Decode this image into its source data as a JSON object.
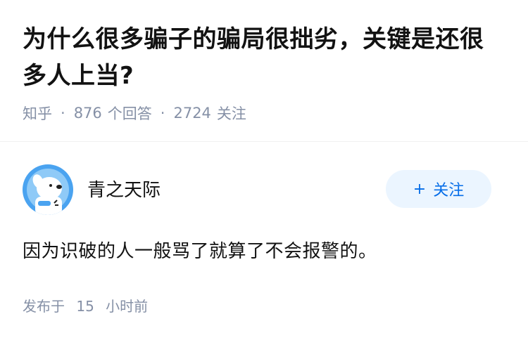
{
  "question": {
    "title": "为什么很多骗子的骗局很拙劣，关键是还很多人上当?",
    "source": "知乎",
    "answer_count": "876",
    "answer_label": "个回答",
    "follow_count": "2724",
    "follow_label": "关注"
  },
  "answer": {
    "author_name": "青之天际",
    "follow_button": "+",
    "follow_label": "关注",
    "content": "因为识破的人一般骂了就算了不会报警的。",
    "posted_prefix": "发布于",
    "posted_number": "15",
    "posted_suffix": "小时前"
  },
  "colors": {
    "accent": "#056de8",
    "accent_bg": "#ebf5ff",
    "meta_text": "#8590a6",
    "avatar_blue": "#4aa3f0"
  }
}
